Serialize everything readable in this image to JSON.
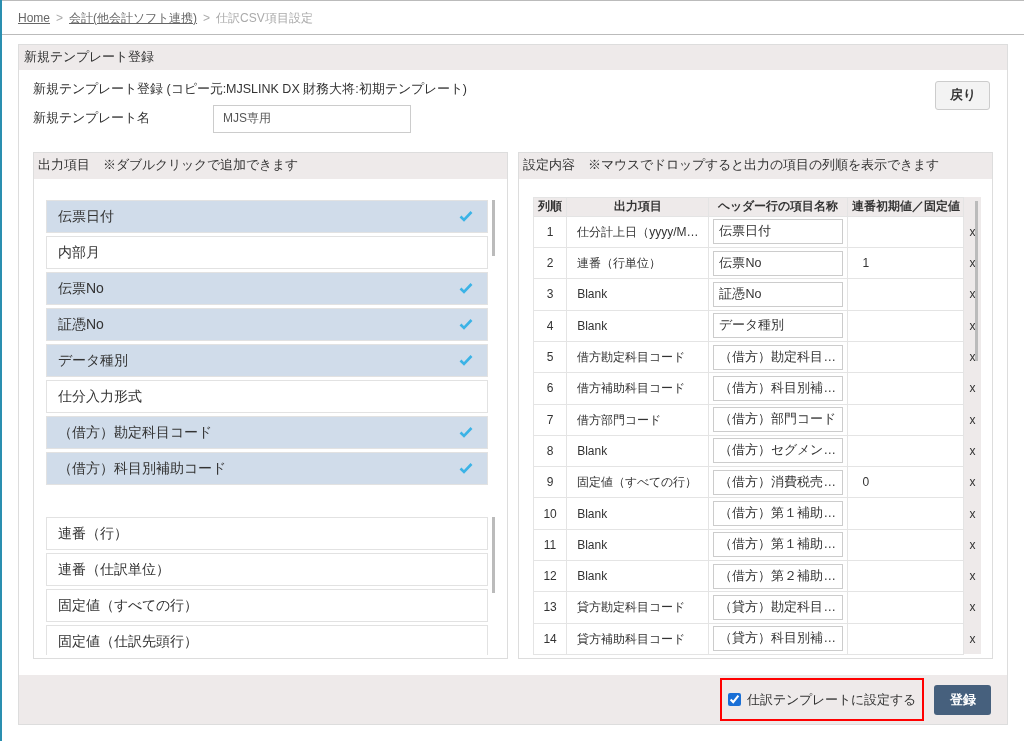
{
  "breadcrumb": [
    {
      "label": "Home",
      "link": true
    },
    {
      "label": ">",
      "link": false
    },
    {
      "label": "会計(他会計ソフト連携)",
      "link": true
    },
    {
      "label": ">",
      "link": false
    },
    {
      "label": "仕訳CSV項目設定",
      "link": false
    }
  ],
  "panel": {
    "title": "新規テンプレート登録",
    "description": "新規テンプレート登録 (コピー元:MJSLINK DX 財務大将:初期テンプレート)",
    "back_button": "戻り",
    "name_label": "新規テンプレート名",
    "name_value": "MJS専用"
  },
  "output_items": {
    "title": "出力項目　※ダブルクリックで追加できます",
    "items": [
      {
        "label": "伝票日付",
        "selected": true
      },
      {
        "label": "内部月",
        "selected": false
      },
      {
        "label": "伝票No",
        "selected": true
      },
      {
        "label": "証憑No",
        "selected": true
      },
      {
        "label": "データ種別",
        "selected": true
      },
      {
        "label": "仕分入力形式",
        "selected": false
      },
      {
        "label": "（借方）勘定科目コード",
        "selected": true
      },
      {
        "label": "（借方）科目別補助コード",
        "selected": true
      }
    ],
    "special_items": [
      {
        "label": "連番（行）"
      },
      {
        "label": "連番（仕訳単位）"
      },
      {
        "label": "固定値（すべての行）"
      },
      {
        "label": "固定値（仕訳先頭行）"
      }
    ]
  },
  "settings": {
    "title": "設定内容　※マウスでドロップすると出力の項目の列順を表示できます",
    "columns": [
      "列順",
      "出力項目",
      "ヘッダー行の項目名称",
      "連番初期値／固定値"
    ],
    "rows": [
      {
        "order": "1",
        "item": "仕分計上日（yyyy/M…",
        "header_name": "伝票日付",
        "remove": "x"
      },
      {
        "order": "2",
        "item": "連番（行単位）",
        "header_name": "伝票No",
        "value": "1",
        "remove": "x"
      },
      {
        "order": "3",
        "item": "Blank",
        "header_name": "証憑No",
        "remove": "x"
      },
      {
        "order": "4",
        "item": "Blank",
        "header_name": "データ種別",
        "remove": "x"
      },
      {
        "order": "5",
        "item": "借方勘定科目コード",
        "header_name": "（借方）勘定科目…",
        "remove": "x"
      },
      {
        "order": "6",
        "item": "借方補助科目コード",
        "header_name": "（借方）科目別補…",
        "remove": "x"
      },
      {
        "order": "7",
        "item": "借方部門コード",
        "header_name": "（借方）部門コード",
        "remove": "x"
      },
      {
        "order": "8",
        "item": "Blank",
        "header_name": "（借方）セグメン…",
        "remove": "x"
      },
      {
        "order": "9",
        "item": "固定値（すべての行）",
        "header_name": "（借方）消費税売…",
        "value": "0",
        "remove": "x"
      },
      {
        "order": "10",
        "item": "Blank",
        "header_name": "（借方）第１補助…",
        "remove": "x"
      },
      {
        "order": "11",
        "item": "Blank",
        "header_name": "（借方）第１補助…",
        "remove": "x"
      },
      {
        "order": "12",
        "item": "Blank",
        "header_name": "（借方）第２補助…",
        "remove": "x"
      },
      {
        "order": "13",
        "item": "貸方勘定科目コード",
        "header_name": "（貸方）勘定科目…",
        "remove": "x"
      },
      {
        "order": "14",
        "item": "貸方補助科目コード",
        "header_name": "（貸方）科目別補…",
        "remove": "x"
      }
    ]
  },
  "footer": {
    "checkbox": {
      "label": "仕訳テンプレートに設定する",
      "checked": true,
      "highlighted": true
    },
    "submit_button": "登録"
  }
}
